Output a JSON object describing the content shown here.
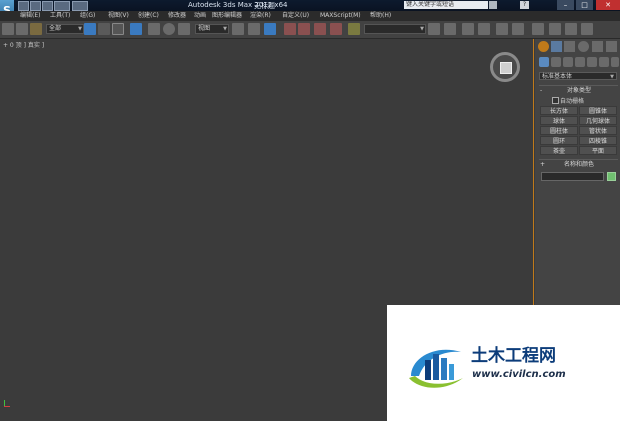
{
  "window": {
    "title": "Autodesk 3ds Max  2012 x64",
    "file": "无标题",
    "search_placeholder": "键入关键字或短语",
    "help_glyph": "?",
    "minimize_glyph": "–",
    "maximize_glyph": "□",
    "close_glyph": "✕",
    "logo_glyph": "S"
  },
  "menu": [
    {
      "label": "编辑(E)"
    },
    {
      "label": "工具(T)"
    },
    {
      "label": "组(G)"
    },
    {
      "label": "视图(V)"
    },
    {
      "label": "创建(C)"
    },
    {
      "label": "修改器"
    },
    {
      "label": "动画"
    },
    {
      "label": "图形编辑器"
    },
    {
      "label": "渲染(R)"
    },
    {
      "label": "自定义(U)"
    },
    {
      "label": "MAXScript(M)"
    },
    {
      "label": "帮助(H)"
    }
  ],
  "toolbar": {
    "selection_filter": "全部",
    "ref_coord": "视图",
    "named_selection": ""
  },
  "viewport": {
    "label": "+ 0 顶 ] 真实 ]"
  },
  "command_panel": {
    "category": "标准基本体",
    "object_type_title": "对象类型",
    "autogrid_label": "自动栅格",
    "buttons": [
      {
        "label": "长方体"
      },
      {
        "label": "圆锥体"
      },
      {
        "label": "球体"
      },
      {
        "label": "几何球体"
      },
      {
        "label": "圆柱体"
      },
      {
        "label": "管状体"
      },
      {
        "label": "圆环"
      },
      {
        "label": "四棱锥"
      },
      {
        "label": "茶壶"
      },
      {
        "label": "平面"
      }
    ],
    "name_color_title": "名称和颜色",
    "rollout_minus": "-",
    "rollout_plus": "+"
  },
  "watermark": {
    "brand_cn": "土木工程网",
    "url": "www.civilcn.com"
  },
  "colors": {
    "accent_border": "#c07a1a",
    "swatch": "#70c070"
  }
}
